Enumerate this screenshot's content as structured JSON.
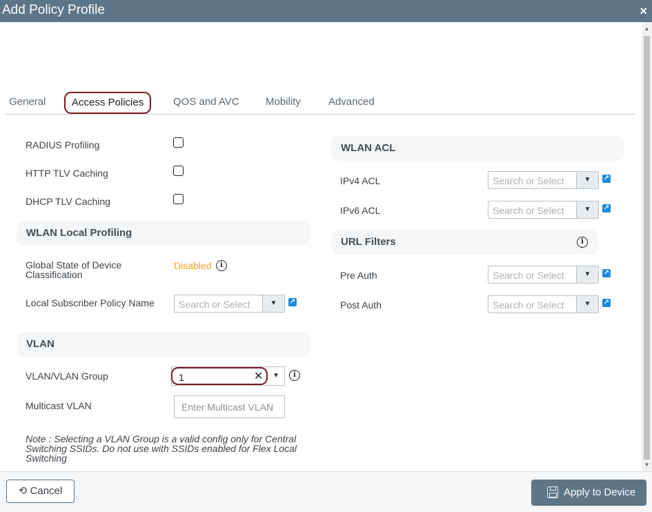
{
  "window": {
    "title": "Add Policy Profile",
    "close_glyph": "×"
  },
  "tabs": [
    {
      "label": "General"
    },
    {
      "label": "Access Policies"
    },
    {
      "label": "QOS and AVC"
    },
    {
      "label": "Mobility"
    },
    {
      "label": "Advanced"
    }
  ],
  "left": {
    "checkboxes": [
      {
        "label": "RADIUS Profiling",
        "checked": false
      },
      {
        "label": "HTTP TLV Caching",
        "checked": false
      },
      {
        "label": "DHCP TLV Caching",
        "checked": false
      }
    ],
    "local_profiling": {
      "header": "WLAN Local Profiling",
      "global_state_label": "Global State of Device Classification",
      "global_state_value": "Disabled",
      "subscriber_label": "Local Subscriber Policy Name",
      "subscriber_placeholder": "Search or Select"
    },
    "vlan": {
      "header": "VLAN",
      "group_label": "VLAN/VLAN Group",
      "group_value": "1",
      "multicast_label": "Multicast VLAN",
      "multicast_placeholder": "Enter Multicast VLAN",
      "note": "Note : Selecting a VLAN Group is a valid config only for Central Switching SSIDs. Do not use with SSIDs enabled for Flex Local Switching"
    }
  },
  "right": {
    "acl": {
      "header": "WLAN ACL",
      "ipv4_label": "IPv4 ACL",
      "ipv6_label": "IPv6 ACL",
      "placeholder": "Search or Select"
    },
    "url": {
      "header": "URL Filters",
      "pre_auth_label": "Pre Auth",
      "post_auth_label": "Post Auth",
      "placeholder": "Search or Select"
    }
  },
  "footer": {
    "cancel_label": "Cancel",
    "apply_label": "Apply to Device"
  },
  "colors": {
    "titlebar": "#5d7687",
    "highlight_border": "#7b1a22",
    "disabled_status": "#f0a31f",
    "external_link_icon": "#1d8ad8"
  }
}
